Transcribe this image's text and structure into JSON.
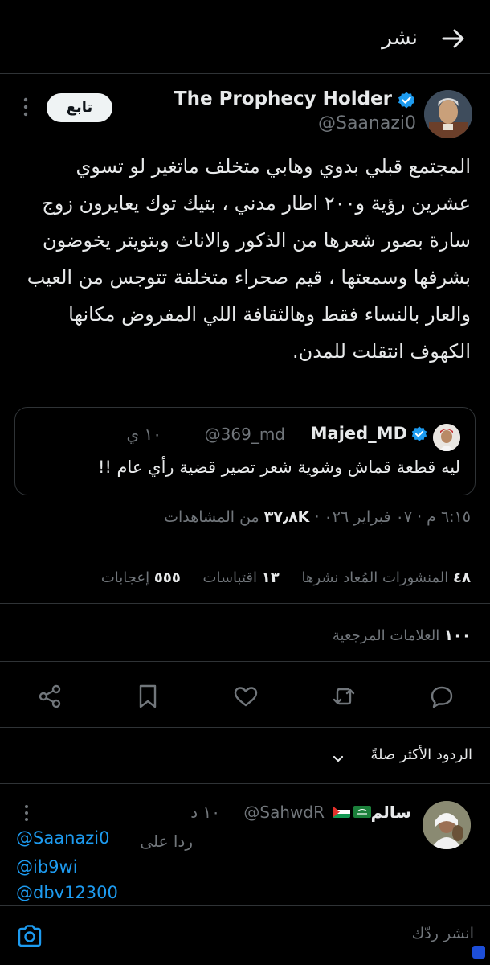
{
  "header": {
    "title": "نشر",
    "back_icon": "arrow-right-icon"
  },
  "tweet": {
    "author_name": "The Prophecy Holder",
    "author_handle": "@Saanazi0",
    "follow_label": "تابع",
    "lines": [
      "المجتمع قبلي بدوي وهابي متخلف ماتغير لو تسوي",
      "عشرين رؤية و٢٠٠ اطار مدني ، بتيك توك يعايرون زوج",
      "سارة بصور شعرها من الذكور والاناث وبتويتر يخوضون",
      "بشرفها وسمعتها ، قيم صحراء متخلفة تتوجس من العيب",
      "والعار بالنساء فقط وهالثقافة اللي المفروض مكانها",
      "الكهوف انتقلت للمدن."
    ],
    "time": "٦:١٥ م",
    "date": "٠٧ فبراير ٠٢٦",
    "views_count": "٣٧٫٨K",
    "views_label": "من المشاهدات"
  },
  "quote": {
    "name": "Majed_MD",
    "handle": "@369_md",
    "time": "١٠ ي",
    "text": "ليه قطعة قماش وشوية شعر تصير قضية رأي عام !!"
  },
  "stats": {
    "reposts_count": "٤٨",
    "reposts_label": "المنشورات المُعاد نشرها",
    "quotes_count": "١٣",
    "quotes_label": "اقتباسات",
    "likes_count": "٥٥٥",
    "likes_label": "إعجابات",
    "bookmarks_count": "١٠٠",
    "bookmarks_label": "العلامات المرجعية"
  },
  "actions": [
    "reply-icon",
    "retweet-icon",
    "like-icon",
    "bookmark-icon",
    "share-icon"
  ],
  "replies_sort": {
    "label": "الردود الأكثر صلةً"
  },
  "reply": {
    "name": "سالم",
    "handle": "@SahwdR",
    "time": "١٠ د",
    "replying_to_label": "ردا على",
    "mentions": [
      "@Saanazi0",
      "@ib9wi",
      "@dbv12300"
    ]
  },
  "composer": {
    "placeholder": "انشر ردّك"
  },
  "colors": {
    "background": "#000000",
    "accent": "#1d9bf0",
    "muted": "#71767b",
    "text": "#e7e9ea",
    "border": "#2f3336"
  }
}
